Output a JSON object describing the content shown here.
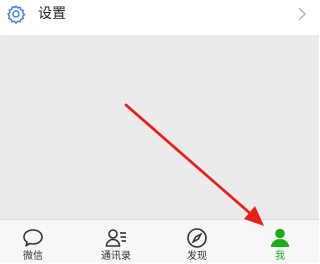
{
  "settings": {
    "label": "设置"
  },
  "tabs": [
    {
      "label": "微信"
    },
    {
      "label": "通讯录"
    },
    {
      "label": "发现"
    },
    {
      "label": "我",
      "active": true
    }
  ],
  "colors": {
    "accent": "#1aad19",
    "settings_icon": "#3f88e0",
    "arrow": "#e8211b",
    "content_bg": "#ebebeb"
  },
  "icons": {
    "settings": "gear-icon",
    "chevron": "chevron-right-icon",
    "chats": "chat-bubble-icon",
    "contacts": "contacts-icon",
    "discover": "compass-icon",
    "me": "person-icon"
  }
}
